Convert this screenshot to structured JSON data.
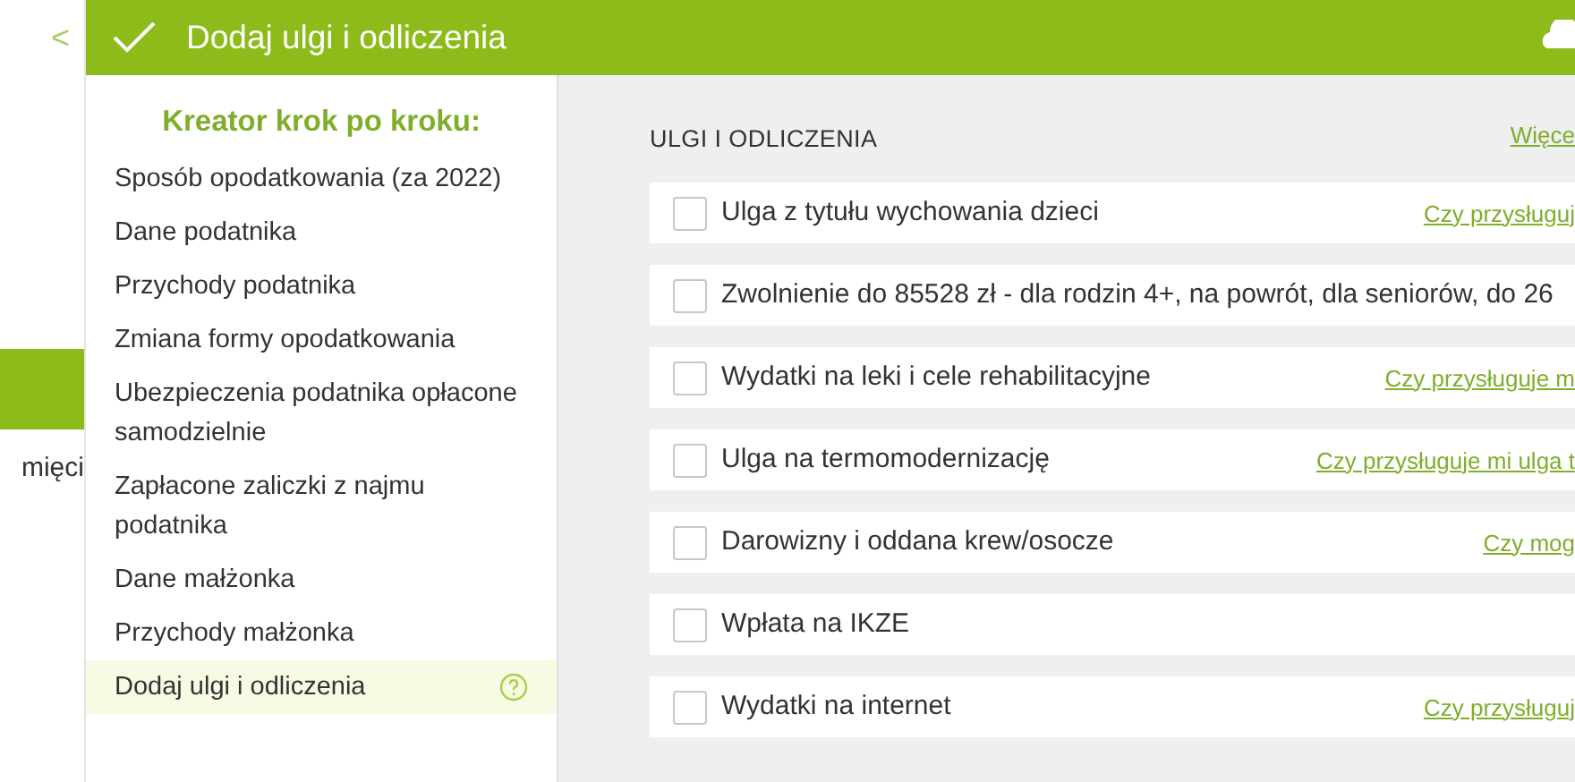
{
  "sidebar": {
    "collapse_icon": "<",
    "items": [
      {
        "selected": true
      },
      {
        "label": "mięci",
        "selected": false
      }
    ]
  },
  "header": {
    "title": "Dodaj ulgi i odliczenia"
  },
  "wizard": {
    "title": "Kreator krok po kroku:",
    "steps": [
      {
        "label": "Sposób opodatkowania (za 2022)",
        "selected": false
      },
      {
        "label": "Dane podatnika",
        "selected": false
      },
      {
        "label": "Przychody podatnika",
        "selected": false
      },
      {
        "label": "Zmiana formy opodatkowania",
        "selected": false
      },
      {
        "label": "Ubezpieczenia podatnika opłacone samodzielnie",
        "selected": false
      },
      {
        "label": "Zapłacone zaliczki z najmu podatnika",
        "selected": false
      },
      {
        "label": "Dane małżonka",
        "selected": false
      },
      {
        "label": "Przychody małżonka",
        "selected": false
      },
      {
        "label": "Dodaj ulgi i odliczenia",
        "selected": true,
        "help": true
      }
    ]
  },
  "section": {
    "title": "ULGI I ODLICZENIA",
    "more_link": "Więce",
    "items": [
      {
        "label": "Ulga z tytułu wychowania dzieci",
        "checked": false,
        "link": "Czy przysługuj"
      },
      {
        "label": "Zwolnienie do 85528 zł - dla rodzin 4+, na powrót, dla seniorów, do 26",
        "checked": false
      },
      {
        "label": "Wydatki na leki i cele rehabilitacyjne",
        "checked": false,
        "link": "Czy przysługuje m"
      },
      {
        "label": "Ulga na termomodernizację",
        "checked": false,
        "link": "Czy przysługuje mi ulga t"
      },
      {
        "label": "Darowizny i oddana krew/osocze",
        "checked": false,
        "link": "Czy mog"
      },
      {
        "label": "Wpłata na IKZE",
        "checked": false
      },
      {
        "label": "Wydatki na internet",
        "checked": false,
        "link": "Czy przysługuj"
      }
    ]
  }
}
